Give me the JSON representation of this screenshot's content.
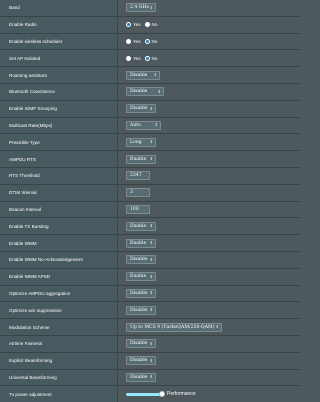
{
  "rows": [
    {
      "label": "Band",
      "type": "select",
      "value": "2.4 GHz"
    },
    {
      "label": "Enable Radio",
      "type": "radio",
      "options": [
        "Yes",
        "No"
      ],
      "selected": "Yes"
    },
    {
      "label": "Enable wireless scheduler",
      "type": "radio",
      "options": [
        "Yes",
        "No"
      ],
      "selected": "No"
    },
    {
      "label": "Set AP Isolated",
      "type": "radio",
      "options": [
        "Yes",
        "No"
      ],
      "selected": "No"
    },
    {
      "label": "Roaming assistant",
      "type": "select",
      "value": "Disable"
    },
    {
      "label": "Bluetooth Coexistence",
      "type": "select",
      "value": "Disable"
    },
    {
      "label": "Enable IGMP Snooping",
      "type": "select",
      "value": "Disable"
    },
    {
      "label": "Multicast Rate(Mbps)",
      "type": "select",
      "value": "Auto"
    },
    {
      "label": "Preamble Type",
      "type": "select",
      "value": "Long"
    },
    {
      "label": "AMPDU RTS",
      "type": "select",
      "value": "Enable"
    },
    {
      "label": "RTS Threshold",
      "type": "input",
      "value": "2347"
    },
    {
      "label": "DTIM Interval",
      "type": "input",
      "value": "3"
    },
    {
      "label": "Beacon Interval",
      "type": "input",
      "value": "100"
    },
    {
      "label": "Enable TX Bursting",
      "type": "select",
      "value": "Enable"
    },
    {
      "label": "Enable WMM",
      "type": "select",
      "value": "Enable"
    },
    {
      "label": "Enable WMM No-Acknowledgement",
      "type": "select",
      "value": "Disable"
    },
    {
      "label": "Enable WMM APSD",
      "type": "select",
      "value": "Enable"
    },
    {
      "label": "Optimize AMPDU aggregation",
      "type": "select",
      "value": "Disable"
    },
    {
      "label": "Optimize ack suppression",
      "type": "select",
      "value": "Disable"
    },
    {
      "label": "Modulation Scheme",
      "type": "select",
      "value": "Up to MCS 9 (TurboQAM/256-QAM)"
    },
    {
      "label": "Airtime Fairness",
      "type": "select",
      "value": "Disable"
    },
    {
      "label": "Explicit Beamforming",
      "type": "select",
      "value": "Disable"
    },
    {
      "label": "Universal Beamforming",
      "type": "select",
      "value": "Disable"
    },
    {
      "label": "Tx power adjustment",
      "type": "slider",
      "value_label": "Performance",
      "level": 1.0
    }
  ],
  "colors": {
    "background": "#4d595d",
    "label_background": "#475a5f",
    "radio_selected": "#1d79ce",
    "slider_track": "#93e7ff"
  },
  "icons": {
    "select_arrow": "updown-arrow-icon",
    "radio": "radio-button-icon"
  }
}
